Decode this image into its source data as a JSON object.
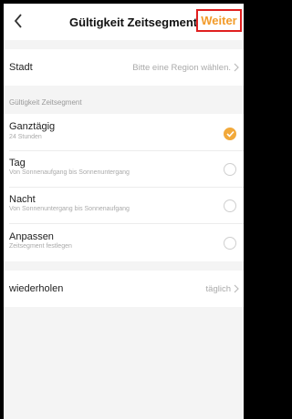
{
  "header": {
    "title": "Gültigkeit Zeitsegment",
    "next_label": "Weiter",
    "back_icon": "chevron-left-icon"
  },
  "city": {
    "label": "Stadt",
    "value": "Bitte eine Region wählen."
  },
  "section": {
    "title": "Gültigkeit Zeitsegment"
  },
  "options": [
    {
      "title": "Ganztägig",
      "subtitle": "24 Stunden",
      "selected": true
    },
    {
      "title": "Tag",
      "subtitle": "Von Sonnenaufgang bis Sonnenuntergang",
      "selected": false
    },
    {
      "title": "Nacht",
      "subtitle": "Von Sonnenuntergang bis Sonnenaufgang",
      "selected": false
    },
    {
      "title": "Anpassen",
      "subtitle": "Zeitsegment festlegen",
      "selected": false
    }
  ],
  "repeat": {
    "label": "wiederholen",
    "value": "täglich"
  },
  "colors": {
    "accent": "#f2a93b",
    "highlight_border": "#e02020"
  }
}
